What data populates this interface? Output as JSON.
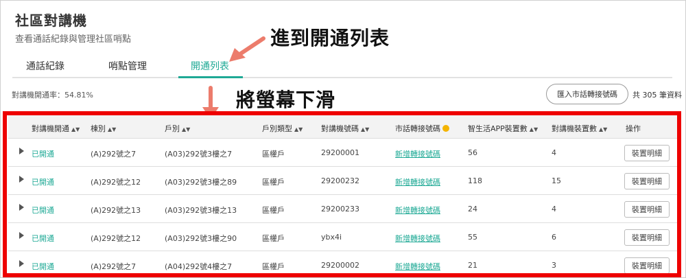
{
  "page": {
    "title": "社區對講機",
    "subtitle": "查看通話紀錄與管理社區哨點"
  },
  "tabs": [
    {
      "label": "通話紀錄"
    },
    {
      "label": "哨點管理"
    },
    {
      "label": "開通列表"
    }
  ],
  "annotations": {
    "top": "進到開通列表",
    "middle": "將螢幕下滑"
  },
  "summary": {
    "rate": "對講機開通率：54.81%",
    "import_button": "匯入市話轉接號碼",
    "total": "共 305 筆資料"
  },
  "table": {
    "headers": [
      "對講機開通",
      "棟別",
      "戶別",
      "戶別類型",
      "對講機號碼",
      "市話轉接號碼",
      "智生活APP裝置數",
      "對講機裝置數",
      "操作"
    ],
    "rows": [
      {
        "status": "已開通",
        "building": "(A)292號之7",
        "unit": "(A03)292號3樓之7",
        "type": "區權戶",
        "phone": "29200001",
        "landline": "新增轉接號碼",
        "app": "56",
        "device": "4",
        "action": "裝置明細"
      },
      {
        "status": "已開通",
        "building": "(A)292號之12",
        "unit": "(A03)292號3樓之89",
        "type": "區權戶",
        "phone": "29200232",
        "landline": "新增轉接號碼",
        "app": "118",
        "device": "15",
        "action": "裝置明細"
      },
      {
        "status": "已開通",
        "building": "(A)292號之13",
        "unit": "(A03)292號3樓之13",
        "type": "區權戶",
        "phone": "29200233",
        "landline": "新增轉接號碼",
        "app": "24",
        "device": "4",
        "action": "裝置明細"
      },
      {
        "status": "已開通",
        "building": "(A)292號之12",
        "unit": "(A03)292號3樓之90",
        "type": "區權戶",
        "phone": "ybx4i",
        "landline": "新增轉接號碼",
        "app": "55",
        "device": "6",
        "action": "裝置明細"
      },
      {
        "status": "已開通",
        "building": "(A)292號之7",
        "unit": "(A04)292號4樓之7",
        "type": "區權戶",
        "phone": "29200002",
        "landline": "新增轉接號碼",
        "app": "21",
        "device": "3",
        "action": "裝置明細"
      }
    ]
  },
  "colors": {
    "accent": "#1ea995",
    "highlight_frame": "#ee0000",
    "arrow": "#ec7c6c",
    "info": "#f4b400"
  }
}
